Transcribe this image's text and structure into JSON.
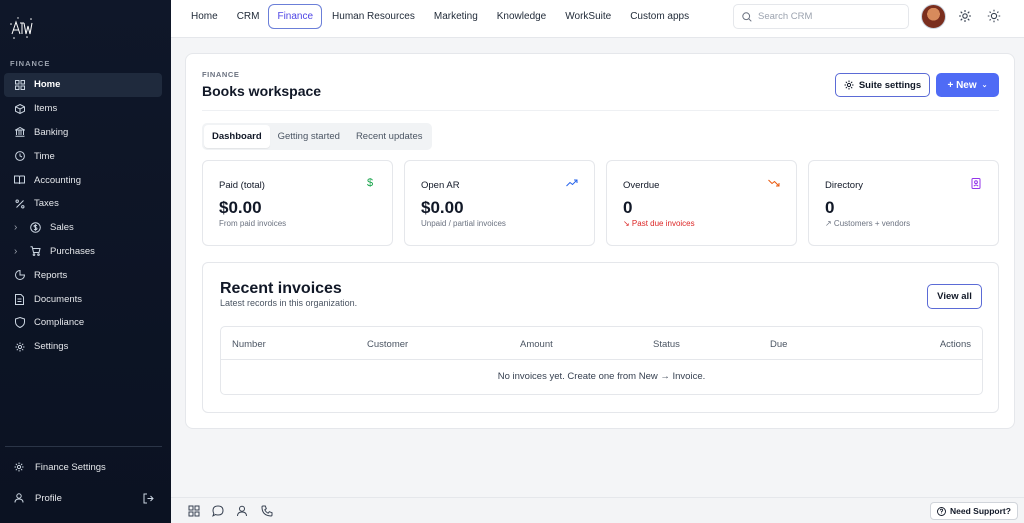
{
  "sidebar": {
    "section_label": "FINANCE",
    "items": [
      {
        "label": "Home",
        "icon": "dashboard-icon"
      },
      {
        "label": "Items",
        "icon": "box-icon"
      },
      {
        "label": "Banking",
        "icon": "bank-icon"
      },
      {
        "label": "Time",
        "icon": "clock-icon"
      },
      {
        "label": "Accounting",
        "icon": "book-icon"
      },
      {
        "label": "Taxes",
        "icon": "percent-icon"
      },
      {
        "label": "Sales",
        "icon": "dollar-circle-icon"
      },
      {
        "label": "Purchases",
        "icon": "cart-icon"
      },
      {
        "label": "Reports",
        "icon": "pie-chart-icon"
      },
      {
        "label": "Documents",
        "icon": "document-icon"
      },
      {
        "label": "Compliance",
        "icon": "shield-icon"
      },
      {
        "label": "Settings",
        "icon": "gear-icon"
      }
    ],
    "finance_settings": "Finance Settings",
    "profile": "Profile"
  },
  "topnav": {
    "tabs": [
      "Home",
      "CRM",
      "Finance",
      "Human Resources",
      "Marketing",
      "Knowledge",
      "WorkSuite",
      "Custom apps"
    ],
    "active_tab": "Finance",
    "search_placeholder": "Search CRM"
  },
  "page": {
    "eyebrow": "FINANCE",
    "title": "Books workspace",
    "suite_settings": "Suite settings",
    "new_button": "+ New",
    "segments": [
      "Dashboard",
      "Getting started",
      "Recent updates"
    ],
    "active_segment": "Dashboard"
  },
  "stats": [
    {
      "label": "Paid (total)",
      "value": "$0.00",
      "sub": "From paid invoices",
      "icon": "$",
      "color": "#16a34a"
    },
    {
      "label": "Open AR",
      "value": "$0.00",
      "sub": "Unpaid / partial invoices",
      "icon": "trend-up-icon",
      "color": "#2563eb"
    },
    {
      "label": "Overdue",
      "value": "0",
      "sub": "↘ Past due invoices",
      "icon": "trend-down-icon",
      "color": "#ea580c"
    },
    {
      "label": "Directory",
      "value": "0",
      "sub": "↗ Customers + vendors",
      "icon": "contact-book-icon",
      "color": "#9333ea"
    }
  ],
  "recent": {
    "title": "Recent invoices",
    "subtitle": "Latest records in this organization.",
    "view_all": "View all",
    "columns": [
      "Number",
      "Customer",
      "Amount",
      "Status",
      "Due",
      "Actions"
    ],
    "empty": "No invoices yet. Create one from New → Invoice."
  },
  "bottombar": {
    "support": "Need Support?"
  }
}
